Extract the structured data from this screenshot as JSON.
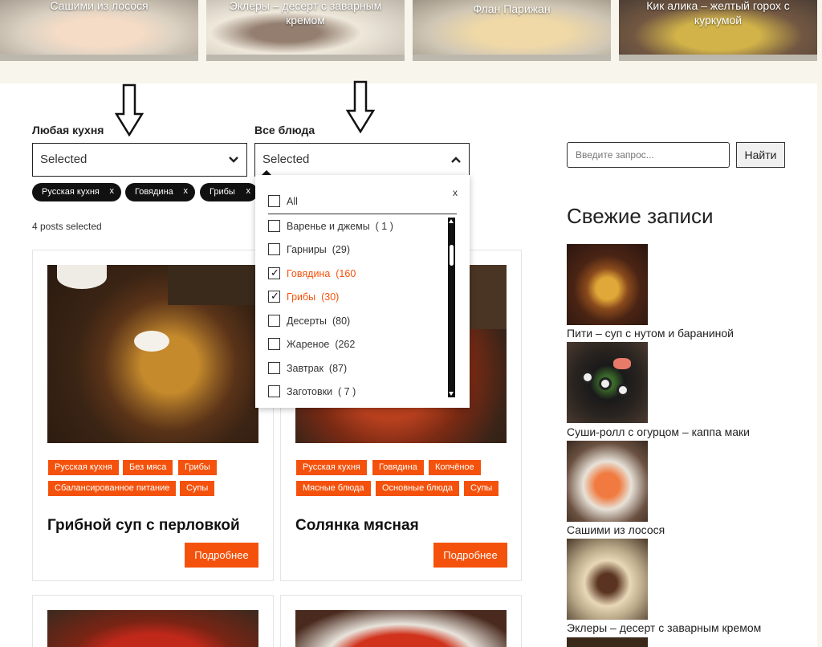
{
  "top_strip": [
    {
      "title": "Сашими из лосося"
    },
    {
      "title": "Эклеры – десерт с заварным кремом"
    },
    {
      "title": "Флан Парижан"
    },
    {
      "title": "Кик алика – желтый горох с куркумой"
    }
  ],
  "filters": {
    "cuisine": {
      "label": "Любая кухня",
      "value": "Selected"
    },
    "dishes": {
      "label": "Все блюда",
      "value": "Selected"
    }
  },
  "selected_chips": [
    {
      "label": "Русская кухня",
      "remove": "x"
    },
    {
      "label": "Говядина",
      "remove": "x"
    },
    {
      "label": "Грибы",
      "remove": "x"
    }
  ],
  "posts_count": "4 posts selected",
  "dropdown": {
    "close": "x",
    "all_label": "All",
    "items": [
      {
        "label": "Варенье и джемы",
        "count": "( 1 )",
        "checked": false
      },
      {
        "label": "Гарниры",
        "count": "(29)",
        "checked": false
      },
      {
        "label": "Говядина",
        "count": "(160",
        "checked": true
      },
      {
        "label": "Грибы",
        "count": "(30)",
        "checked": true
      },
      {
        "label": "Десерты",
        "count": "(80)",
        "checked": false
      },
      {
        "label": "Жареное",
        "count": "(262",
        "checked": false
      },
      {
        "label": "Завтрак",
        "count": "(87)",
        "checked": false
      },
      {
        "label": "Заготовки",
        "count": "( 7 )",
        "checked": false
      }
    ]
  },
  "cards": [
    {
      "tags": [
        "Русская кухня",
        "Без мяса",
        "Грибы",
        "Сбалансированное питание",
        "Супы"
      ],
      "title": "Грибной суп с перловкой",
      "button": "Подробнее"
    },
    {
      "tags": [
        "Русская кухня",
        "Говядина",
        "Копчёное",
        "Мясные блюда",
        "Основные блюда",
        "Супы"
      ],
      "title": "Солянка мясная",
      "button": "Подробнее"
    }
  ],
  "sidebar": {
    "search_placeholder": "Введите запрос...",
    "search_button": "Найти",
    "heading": "Свежие записи",
    "recent": [
      {
        "title": "Пити – суп с нутом и бараниной"
      },
      {
        "title": "Суши-ролл с огурцом – каппа маки"
      },
      {
        "title": "Сашими из лосося"
      },
      {
        "title": "Эклеры – десерт с заварным кремом"
      }
    ]
  },
  "colors": {
    "accent": "#f4520c",
    "chip_bg": "#111111"
  }
}
